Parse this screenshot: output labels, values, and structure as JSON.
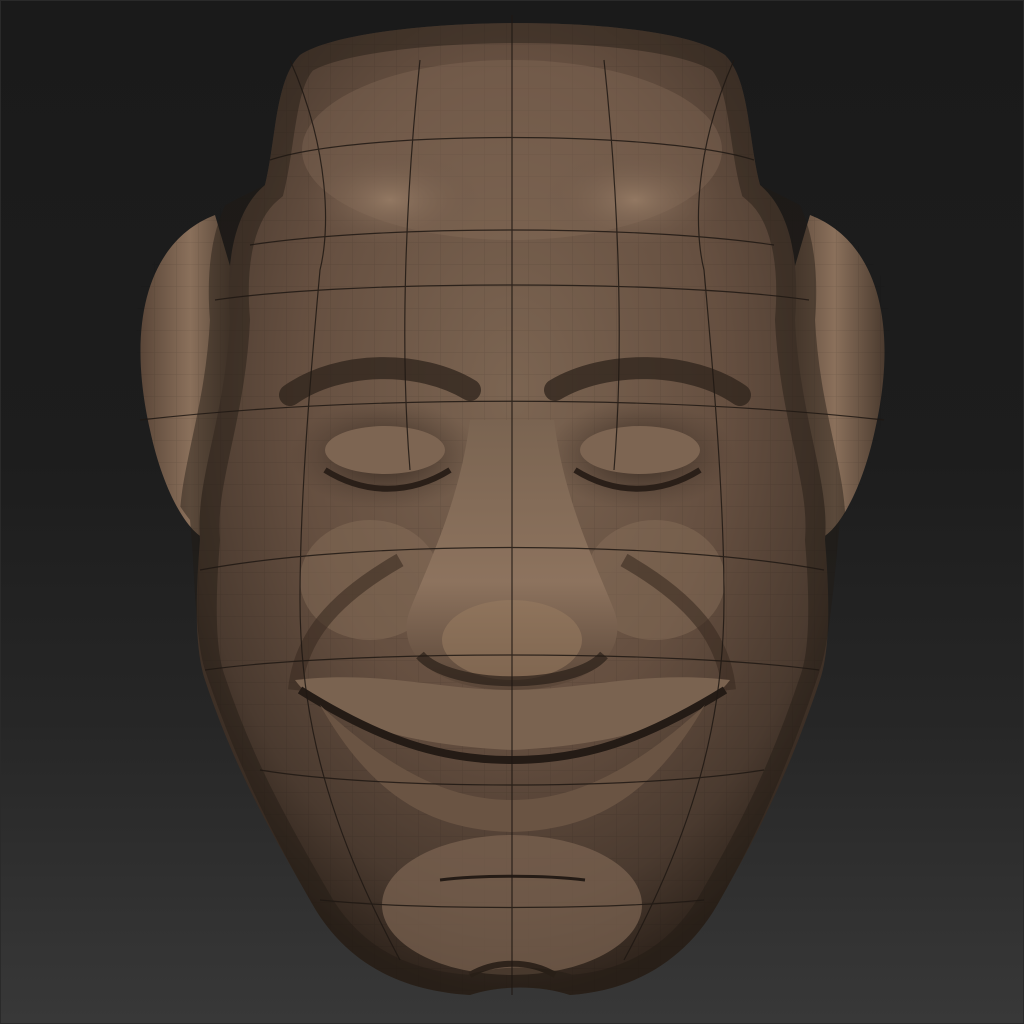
{
  "viewport": {
    "background_top": "#1a1a1a",
    "background_bottom": "#383838"
  },
  "model": {
    "subject": "sculpted-head-mesh",
    "material_base": "#6e5747",
    "material_highlight": "#a88b72",
    "material_shadow": "#2e231b",
    "wireframe_color": "#1f1813",
    "polyframe": true
  }
}
